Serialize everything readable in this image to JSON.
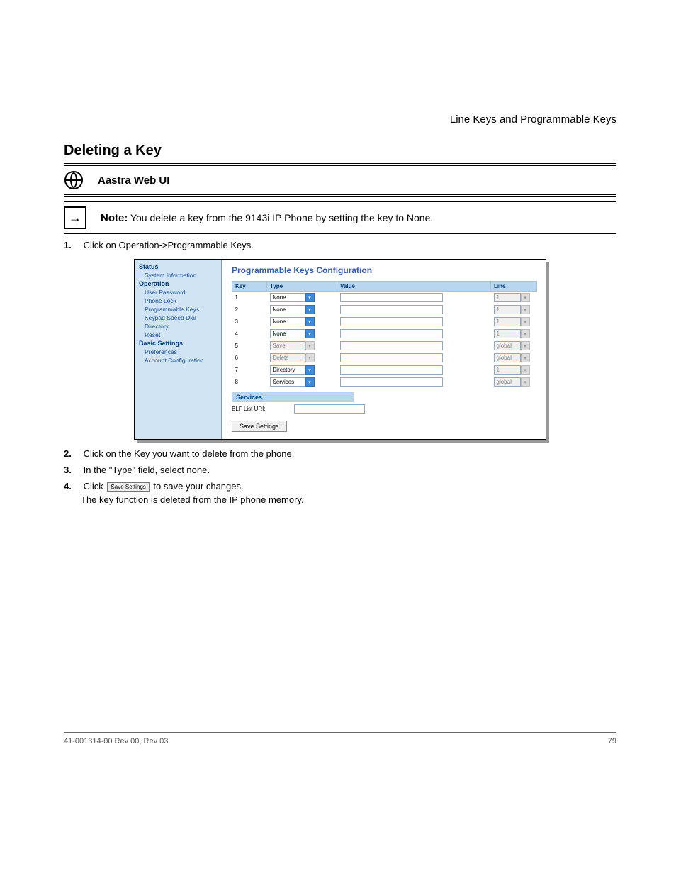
{
  "header_right": "Line Keys and Programmable Keys",
  "section_title": "Deleting a Key",
  "web_label": "Aastra Web UI",
  "note_label": "Note:",
  "note_body": "You delete a key from the 9143i IP Phone by setting the key to None.",
  "step1_num": "1.",
  "step1_text": "Click on Operation->Programmable Keys.",
  "step2_num": "2.",
  "step2_text": "Click on the Key you want to delete from the phone.",
  "step3_num": "3.",
  "step3_text": "In the \"Type\" field, select none.",
  "step4_num": "4.",
  "step4_prefix": "Click",
  "step4_icon": "Save Settings",
  "step4_suffix": "to save your changes.",
  "step4_extra": "The key function is deleted from the IP phone memory.",
  "screenshot": {
    "title": "Programmable Keys Configuration",
    "sidebar": {
      "groups": [
        {
          "label": "Status",
          "items": [
            "System Information"
          ]
        },
        {
          "label": "Operation",
          "items": [
            "User Password",
            "Phone Lock",
            "Programmable Keys",
            "Keypad Speed Dial",
            "Directory",
            "Reset"
          ]
        },
        {
          "label": "Basic Settings",
          "items": [
            "Preferences",
            "Account Configuration"
          ]
        }
      ]
    },
    "columns": {
      "key": "Key",
      "type": "Type",
      "value": "Value",
      "line": "Line"
    },
    "rows": [
      {
        "key": "1",
        "type": "None",
        "type_disabled": false,
        "line": "1",
        "line_disabled": true
      },
      {
        "key": "2",
        "type": "None",
        "type_disabled": false,
        "line": "1",
        "line_disabled": true
      },
      {
        "key": "3",
        "type": "None",
        "type_disabled": false,
        "line": "1",
        "line_disabled": true
      },
      {
        "key": "4",
        "type": "None",
        "type_disabled": false,
        "line": "1",
        "line_disabled": true
      },
      {
        "key": "5",
        "type": "Save",
        "type_disabled": true,
        "line": "global",
        "line_disabled": true
      },
      {
        "key": "6",
        "type": "Delete",
        "type_disabled": true,
        "line": "global",
        "line_disabled": true
      },
      {
        "key": "7",
        "type": "Directory",
        "type_disabled": false,
        "line": "1",
        "line_disabled": true
      },
      {
        "key": "8",
        "type": "Services",
        "type_disabled": false,
        "line": "global",
        "line_disabled": true
      }
    ],
    "services_hdr": "Services",
    "blf_label": "BLF List URI:",
    "save_btn": "Save Settings"
  },
  "footer": {
    "left": "41-001314-00 Rev 00, Rev 03",
    "right": "79"
  }
}
